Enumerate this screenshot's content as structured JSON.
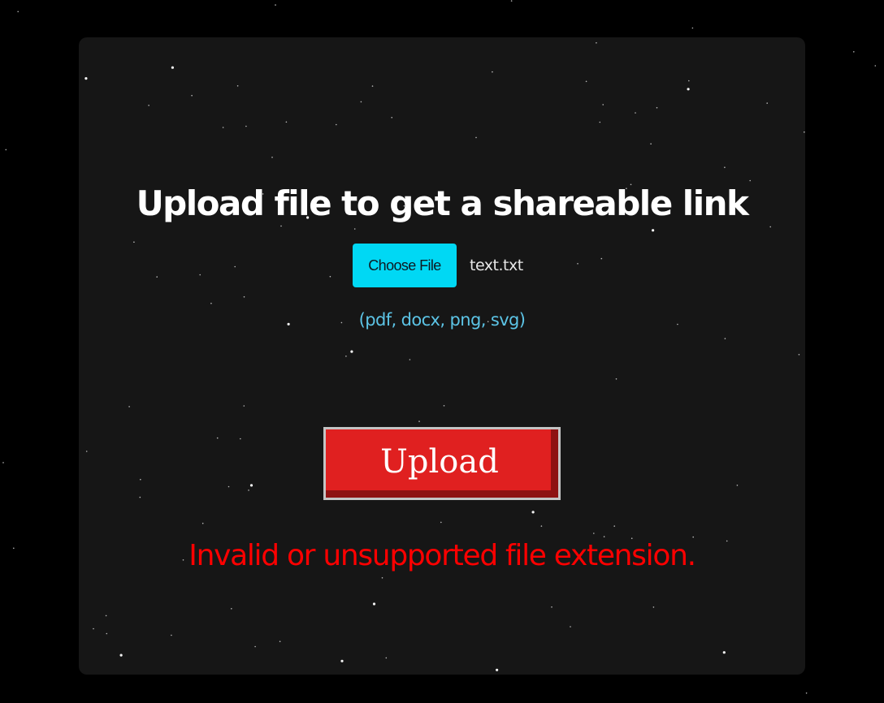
{
  "page": {
    "title": "Upload file to get a shareable link"
  },
  "file_input": {
    "button_label": "Choose File",
    "selected_file": "text.txt",
    "allowed_types": "(pdf, docx, png, svg)"
  },
  "actions": {
    "upload_label": "Upload"
  },
  "status": {
    "error_message": "Invalid or unsupported file extension."
  },
  "colors": {
    "background": "#000000",
    "card": "#161616",
    "choose_button": "#00d8f4",
    "allowed_types_text": "#5cc4e6",
    "upload_button": "#e02020",
    "error_text": "#ff0000"
  }
}
